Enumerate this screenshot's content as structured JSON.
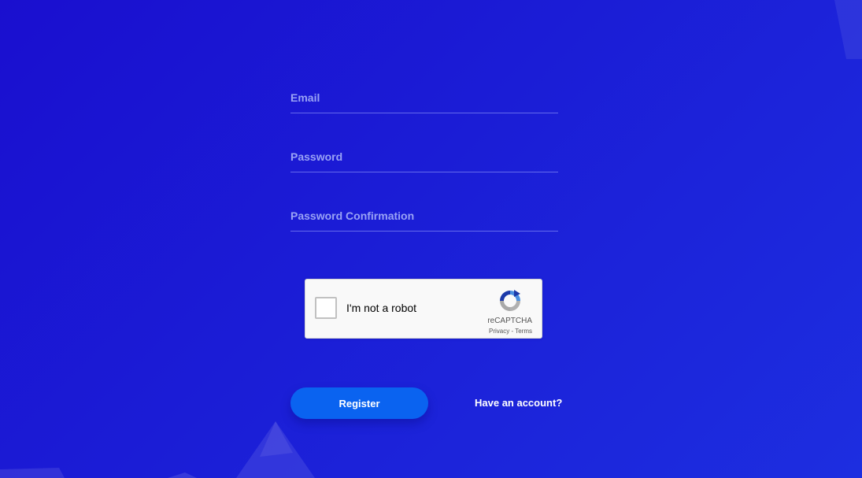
{
  "form": {
    "email_placeholder": "Email",
    "password_placeholder": "Password",
    "password_confirmation_placeholder": "Password Confirmation",
    "email_value": "",
    "password_value": "",
    "password_confirmation_value": ""
  },
  "captcha": {
    "label": "I'm not a robot",
    "brand": "reCAPTCHA",
    "privacy": "Privacy",
    "separator": " - ",
    "terms": "Terms",
    "checked": false
  },
  "actions": {
    "register_label": "Register",
    "have_account_label": "Have an account?"
  },
  "colors": {
    "background": "#1b1dd6",
    "primary_button": "#0a63f0",
    "placeholder": "#9aa3f5"
  }
}
